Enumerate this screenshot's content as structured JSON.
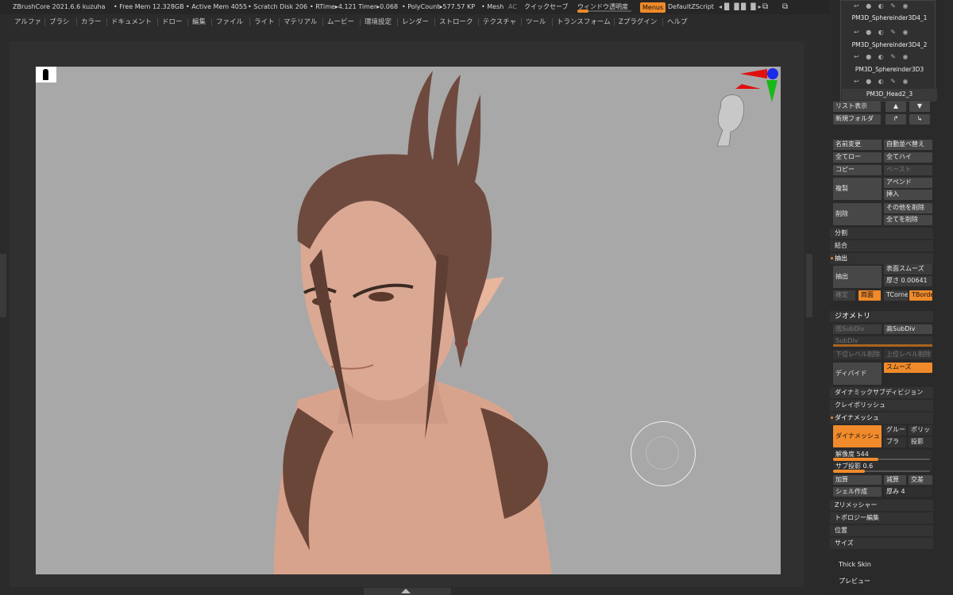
{
  "status": {
    "app_title": "ZBrushCore 2021.6.6 kuzuha",
    "free_mem": "• Free Mem 12.328GB",
    "active_mem": "• Active Mem 4055",
    "scratch_disk": "• Scratch Disk 206",
    "rtime": "• RTime▸4.121 Timer▸0.068",
    "polycount": "• PolyCount▸577.57 KP",
    "mesh": "• Mesh",
    "ac": "AC",
    "quicksave": "クイックセーブ",
    "window_transparency": "ウィンドウ透明度",
    "menus": "Menus",
    "zscript": "DefaultZScript",
    "window_transparency_value": 0.2
  },
  "menu": [
    "アルファ",
    "ブラシ",
    "カラー",
    "ドキュメント",
    "ドロー",
    "編集",
    "ファイル",
    "ライト",
    "マテリアル",
    "ムービー",
    "環境設定",
    "レンダー",
    "ストローク",
    "テクスチャ",
    "ツール",
    "トランスフォーム",
    "Zプラグイン",
    "ヘルプ"
  ],
  "subtools": [
    "PM3D_Sphereinder3D4_1",
    "PM3D_Sphereinder3D4_2",
    "PM3D_Sphereinder3D3",
    "PM3D_Head2_3"
  ],
  "panel": {
    "list_view": "リスト表示",
    "new_folder": "新規フォルダ",
    "rename": "名前変更",
    "auto_reorder": "自動並べ替え",
    "all_low": "全てロー",
    "all_high": "全てハイ",
    "copy": "コピー",
    "paste": "ペースト",
    "duplicate": "複製",
    "append": "アペンド",
    "insert": "挿入",
    "delete": "削除",
    "delete_other": "その他を削除",
    "delete_all": "全てを削除",
    "split": "分割",
    "merge": "結合",
    "extract_section": "抽出",
    "extract_button": "抽出",
    "smooth_surface": "表面スムーズ",
    "thickness": "厚さ 0.00641",
    "accept": "確定",
    "double": "両面",
    "tcorner": "TCorne",
    "tborder": "TBorde",
    "geometry": "ジオメトリ",
    "lower_subdiv": "低SubDiv",
    "higher_subdiv": "高SubDiv",
    "subdiv": "SubDiv",
    "del_lower": "下位レベル削除",
    "del_higher": "上位レベル削除",
    "divide": "ディバイド",
    "smooth": "スムーズ",
    "dynamic_subdiv": "ダイナミックサブディビジョン",
    "clay_polish": "クレイポリッシュ",
    "dynamesh_section": "ダイナメッシュ",
    "dynamesh_button": "ダイナメッシュ",
    "groups": "グルー",
    "blur": "ブラ",
    "polish": "ポリッ",
    "project": "投影",
    "resolution": "解像度 544",
    "sub_projection": "サブ投影 0.6",
    "add": "加算",
    "subtract": "減算",
    "intersect": "交差",
    "create_shell": "シェル作成",
    "thickness2": "厚み 4",
    "zremesher": "Zリメッシャー",
    "topology": "トポロジー編集",
    "position": "位置",
    "size": "サイズ",
    "thick_skin": "Thick Skin",
    "preview": "プレビュー",
    "resolution_level": 0.47,
    "sub_projection_level": 0.6
  },
  "colors": {
    "accent": "#f08a2a",
    "canvas": "#a8a8a8",
    "skin": "#d9a58f",
    "hair": "#6e4a3e"
  }
}
